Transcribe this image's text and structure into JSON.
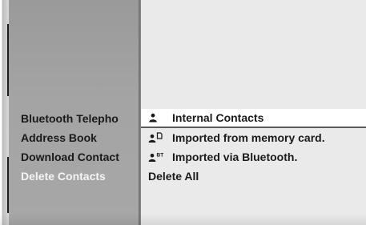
{
  "menu": {
    "items": [
      {
        "label": "Bluetooth Telepho",
        "active": false
      },
      {
        "label": "Address Book",
        "active": false
      },
      {
        "label": "Download Contact",
        "active": false
      },
      {
        "label": "Delete Contacts",
        "active": true
      }
    ]
  },
  "submenu": {
    "items": [
      {
        "label": "Internal Contacts",
        "icon": "person-icon",
        "selected": true
      },
      {
        "label": "Imported from memory card.",
        "icon": "memory-card-contact-icon",
        "selected": false
      },
      {
        "label": "Imported via Bluetooth.",
        "icon": "bluetooth-contact-icon",
        "selected": false
      },
      {
        "label": "Delete All",
        "icon": null,
        "selected": false
      }
    ]
  },
  "colors": {
    "menu_panel": "#a4a4a4",
    "right_panel": "#eaeaea",
    "selected_row": "#ffffff",
    "active_text": "#f4f4f4",
    "text": "#1a1a1a"
  }
}
